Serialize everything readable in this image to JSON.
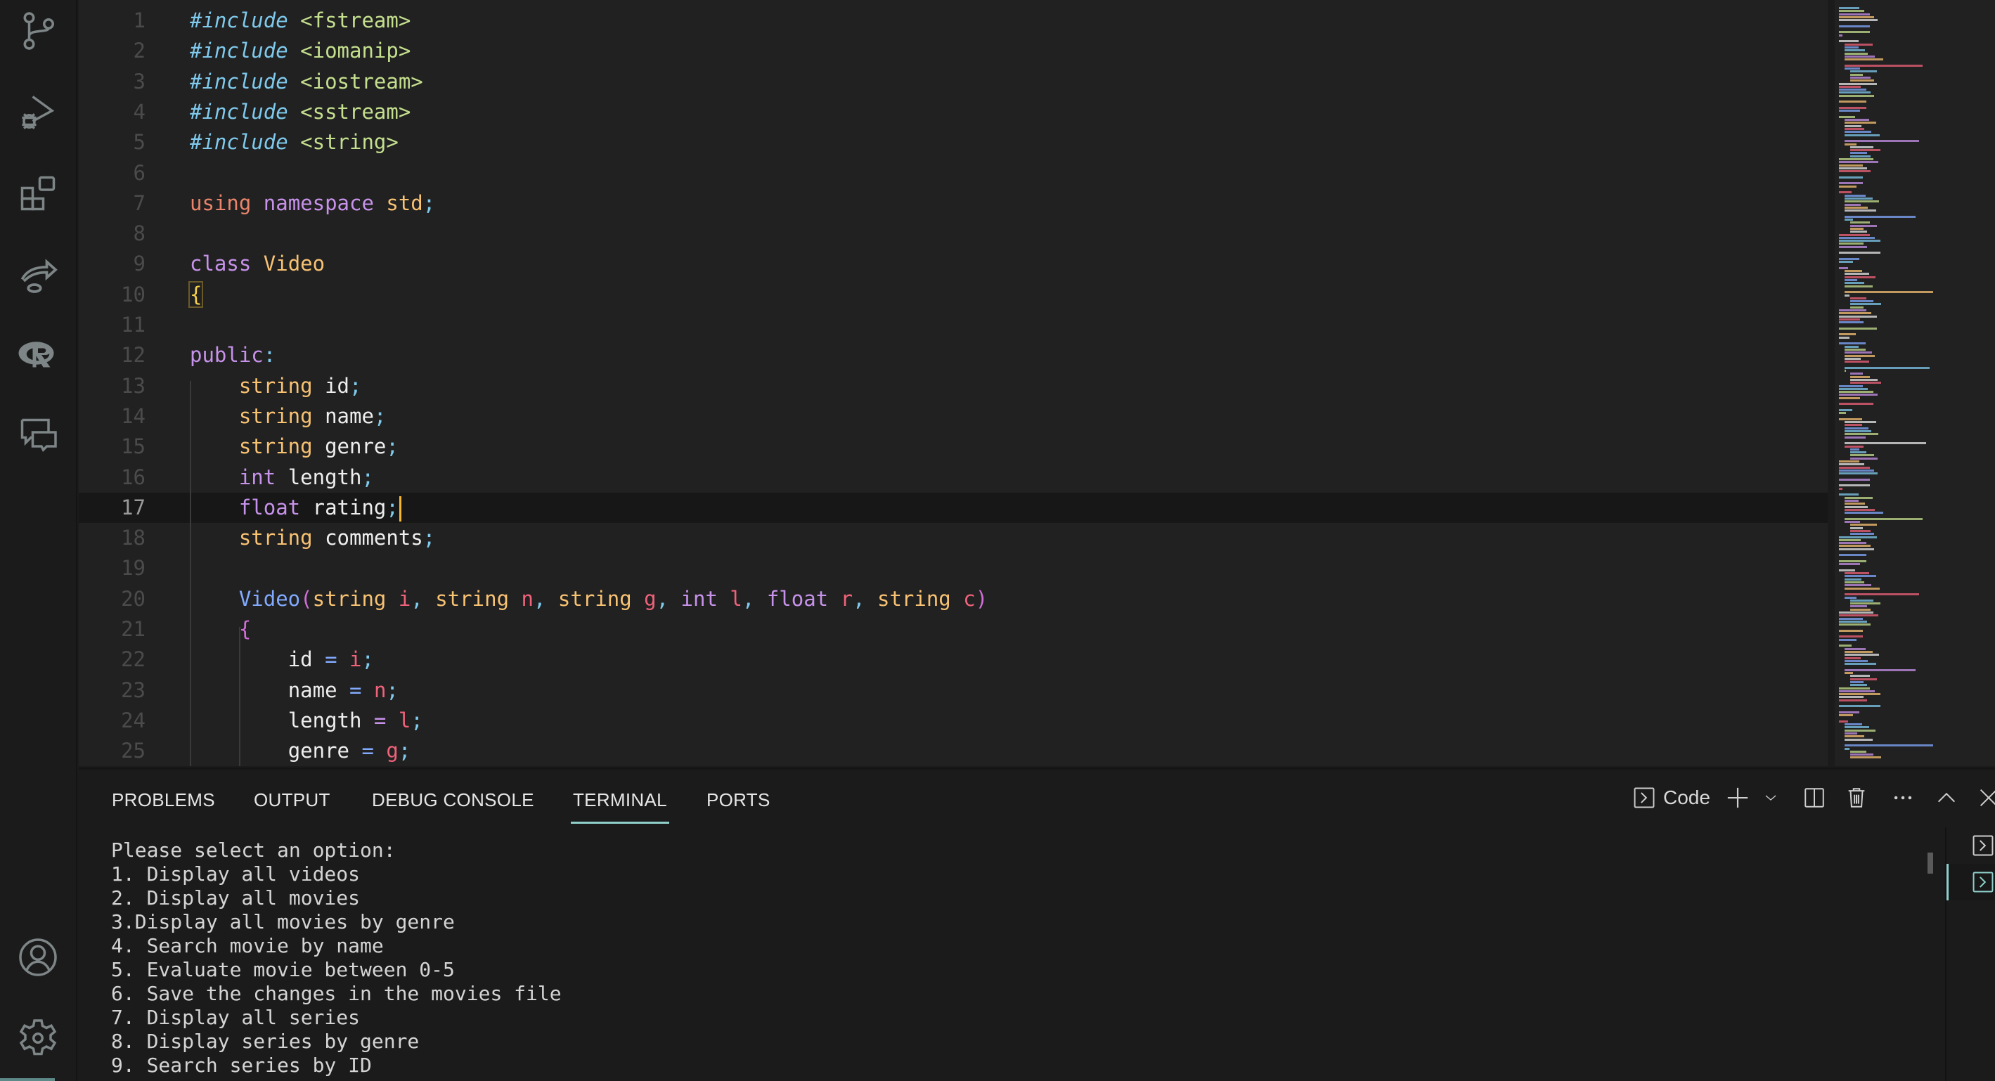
{
  "activity_bar": {
    "items": [
      {
        "name": "source-control",
        "icon": "source-control-icon"
      },
      {
        "name": "run-and-debug",
        "icon": "run-debug-icon"
      },
      {
        "name": "extensions",
        "icon": "extensions-icon"
      },
      {
        "name": "remote-share",
        "icon": "share-arrow-icon"
      },
      {
        "name": "r-language",
        "icon": "r-logo-icon"
      },
      {
        "name": "comments",
        "icon": "comments-icon"
      }
    ],
    "bottom_items": [
      {
        "name": "accounts",
        "icon": "account-icon"
      },
      {
        "name": "manage",
        "icon": "gear-icon"
      }
    ]
  },
  "editor": {
    "current_line": 17,
    "lines": [
      {
        "n": "1",
        "tokens": [
          [
            "#include",
            "t-pre"
          ],
          [
            " ",
            ""
          ],
          [
            "<fstream>",
            "t-inc"
          ]
        ]
      },
      {
        "n": "2",
        "tokens": [
          [
            "#include",
            "t-pre"
          ],
          [
            " ",
            ""
          ],
          [
            "<iomanip>",
            "t-inc"
          ]
        ]
      },
      {
        "n": "3",
        "tokens": [
          [
            "#include",
            "t-pre"
          ],
          [
            " ",
            ""
          ],
          [
            "<iostream>",
            "t-inc"
          ]
        ]
      },
      {
        "n": "4",
        "tokens": [
          [
            "#include",
            "t-pre"
          ],
          [
            " ",
            ""
          ],
          [
            "<sstream>",
            "t-inc"
          ]
        ]
      },
      {
        "n": "5",
        "tokens": [
          [
            "#include",
            "t-pre"
          ],
          [
            " ",
            ""
          ],
          [
            "<string>",
            "t-inc"
          ]
        ]
      },
      {
        "n": "6",
        "tokens": []
      },
      {
        "n": "7",
        "tokens": [
          [
            "using",
            "t-kw"
          ],
          [
            " ",
            ""
          ],
          [
            "namespace",
            "t-kw2"
          ],
          [
            " ",
            ""
          ],
          [
            "std",
            "t-type"
          ],
          [
            ";",
            "t-punc"
          ]
        ]
      },
      {
        "n": "8",
        "tokens": []
      },
      {
        "n": "9",
        "tokens": [
          [
            "class",
            "t-kw2"
          ],
          [
            " ",
            ""
          ],
          [
            "Video",
            "t-type"
          ]
        ]
      },
      {
        "n": "10",
        "tokens": [
          [
            "{",
            "t-brace bracket-box"
          ]
        ]
      },
      {
        "n": "11",
        "tokens": []
      },
      {
        "n": "12",
        "tokens": [
          [
            "public",
            "t-kw2"
          ],
          [
            ":",
            "t-punc"
          ]
        ]
      },
      {
        "n": "13",
        "tokens": [
          [
            "    ",
            ""
          ],
          [
            "string",
            "t-type"
          ],
          [
            " ",
            ""
          ],
          [
            "id",
            "t-var"
          ],
          [
            ";",
            "t-punc"
          ]
        ]
      },
      {
        "n": "14",
        "tokens": [
          [
            "    ",
            ""
          ],
          [
            "string",
            "t-type"
          ],
          [
            " ",
            ""
          ],
          [
            "name",
            "t-var"
          ],
          [
            ";",
            "t-punc"
          ]
        ]
      },
      {
        "n": "15",
        "tokens": [
          [
            "    ",
            ""
          ],
          [
            "string",
            "t-type"
          ],
          [
            " ",
            ""
          ],
          [
            "genre",
            "t-var"
          ],
          [
            ";",
            "t-punc"
          ]
        ]
      },
      {
        "n": "16",
        "tokens": [
          [
            "    ",
            ""
          ],
          [
            "int",
            "t-kw2"
          ],
          [
            " ",
            ""
          ],
          [
            "length",
            "t-var"
          ],
          [
            ";",
            "t-punc"
          ]
        ]
      },
      {
        "n": "17",
        "tokens": [
          [
            "    ",
            ""
          ],
          [
            "float",
            "t-kw2"
          ],
          [
            " ",
            ""
          ],
          [
            "rating",
            "t-var"
          ],
          [
            ";",
            "t-punc"
          ]
        ]
      },
      {
        "n": "18",
        "tokens": [
          [
            "    ",
            ""
          ],
          [
            "string",
            "t-type"
          ],
          [
            " ",
            ""
          ],
          [
            "comments",
            "t-var"
          ],
          [
            ";",
            "t-punc"
          ]
        ]
      },
      {
        "n": "19",
        "tokens": []
      },
      {
        "n": "20",
        "tokens": [
          [
            "    ",
            ""
          ],
          [
            "Video",
            "t-fn"
          ],
          [
            "(",
            "t-paren"
          ],
          [
            "string",
            "t-type"
          ],
          [
            " ",
            ""
          ],
          [
            "i",
            "t-param"
          ],
          [
            ",",
            "t-punc"
          ],
          [
            " ",
            ""
          ],
          [
            "string",
            "t-type"
          ],
          [
            " ",
            ""
          ],
          [
            "n",
            "t-param"
          ],
          [
            ",",
            "t-punc"
          ],
          [
            " ",
            ""
          ],
          [
            "string",
            "t-type"
          ],
          [
            " ",
            ""
          ],
          [
            "g",
            "t-param"
          ],
          [
            ",",
            "t-punc"
          ],
          [
            " ",
            ""
          ],
          [
            "int",
            "t-kw2"
          ],
          [
            " ",
            ""
          ],
          [
            "l",
            "t-param"
          ],
          [
            ",",
            "t-punc"
          ],
          [
            " ",
            ""
          ],
          [
            "float",
            "t-kw2"
          ],
          [
            " ",
            ""
          ],
          [
            "r",
            "t-param"
          ],
          [
            ",",
            "t-punc"
          ],
          [
            " ",
            ""
          ],
          [
            "string",
            "t-type"
          ],
          [
            " ",
            ""
          ],
          [
            "c",
            "t-param"
          ],
          [
            ")",
            "t-paren"
          ]
        ]
      },
      {
        "n": "21",
        "tokens": [
          [
            "    ",
            ""
          ],
          [
            "{",
            "t-paren"
          ]
        ]
      },
      {
        "n": "22",
        "tokens": [
          [
            "        ",
            ""
          ],
          [
            "id",
            "t-var"
          ],
          [
            " ",
            ""
          ],
          [
            "=",
            "t-fn"
          ],
          [
            " ",
            ""
          ],
          [
            "i",
            "t-param"
          ],
          [
            ";",
            "t-punc"
          ]
        ]
      },
      {
        "n": "23",
        "tokens": [
          [
            "        ",
            ""
          ],
          [
            "name",
            "t-var"
          ],
          [
            " ",
            ""
          ],
          [
            "=",
            "t-fn"
          ],
          [
            " ",
            ""
          ],
          [
            "n",
            "t-param"
          ],
          [
            ";",
            "t-punc"
          ]
        ]
      },
      {
        "n": "24",
        "tokens": [
          [
            "        ",
            ""
          ],
          [
            "length",
            "t-var"
          ],
          [
            " ",
            ""
          ],
          [
            "=",
            "t-kw2"
          ],
          [
            " ",
            ""
          ],
          [
            "l",
            "t-param"
          ],
          [
            ";",
            "t-punc"
          ]
        ]
      },
      {
        "n": "25",
        "tokens": [
          [
            "        ",
            ""
          ],
          [
            "genre",
            "t-var"
          ],
          [
            " ",
            ""
          ],
          [
            "=",
            "t-fn"
          ],
          [
            " ",
            ""
          ],
          [
            "g",
            "t-param"
          ],
          [
            ";",
            "t-punc"
          ]
        ]
      }
    ]
  },
  "panel": {
    "tabs": [
      {
        "label": "PROBLEMS",
        "active": false
      },
      {
        "label": "OUTPUT",
        "active": false
      },
      {
        "label": "DEBUG CONSOLE",
        "active": false
      },
      {
        "label": "TERMINAL",
        "active": true
      },
      {
        "label": "PORTS",
        "active": false
      }
    ],
    "terminal_name": "Code",
    "actions": [
      "new-terminal",
      "launch-profile",
      "split-terminal",
      "kill-terminal",
      "more-actions",
      "maximize-panel",
      "close-panel"
    ],
    "terminal_output": [
      "Please select an option:",
      "1. Display all videos",
      "2. Display all movies",
      "3.Display all movies by genre",
      "4. Search movie by name",
      "5. Evaluate movie between 0-5",
      "6. Save the changes in the movies file",
      "7. Display all series",
      "8. Display series by genre",
      "9. Search series by ID"
    ],
    "terminal_instances": [
      {
        "name": "terminal-1",
        "active": false
      },
      {
        "name": "terminal-2",
        "active": true
      }
    ]
  },
  "colors": {
    "accent": "#8fd0cb",
    "cursor": "#f5b82d",
    "editor_bg": "#212121",
    "panel_bg": "#1b1b1b"
  }
}
